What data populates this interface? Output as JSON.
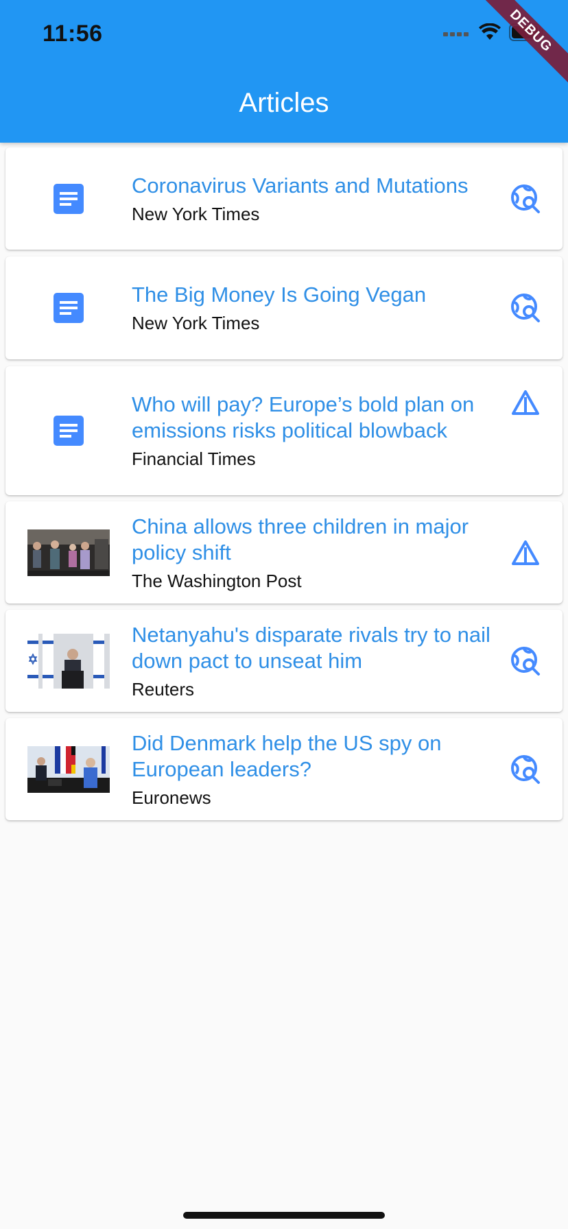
{
  "status_bar": {
    "time": "11:56"
  },
  "app_bar": {
    "title": "Articles",
    "debug_banner": "DEBUG",
    "color": "#2196f3"
  },
  "colors": {
    "title_text": "#2f8fe6",
    "icon": "#448aff"
  },
  "articles": [
    {
      "title": "Coronavirus Variants and Mutations",
      "source": "New York Times",
      "leading": "article-icon",
      "trailing": "travel-explore-icon"
    },
    {
      "title": "The Big Money Is Going Vegan",
      "source": "New York Times",
      "leading": "article-icon",
      "trailing": "travel-explore-icon"
    },
    {
      "title": "Who will pay? Europe’s bold plan on emissions risks political blowback",
      "source": "Financial Times",
      "leading": "article-icon",
      "trailing": "change-history-icon"
    },
    {
      "title": "China allows three children in major policy shift",
      "source": "The Washington Post",
      "leading": "thumbnail-image",
      "trailing": "change-history-icon"
    },
    {
      "title": "Netanyahu's disparate rivals try to nail down pact to unseat him",
      "source": "Reuters",
      "leading": "thumbnail-image",
      "trailing": "travel-explore-icon"
    },
    {
      "title": "Did Denmark help the US spy on European leaders?",
      "source": "Euronews",
      "leading": "thumbnail-image",
      "trailing": "travel-explore-icon"
    }
  ]
}
